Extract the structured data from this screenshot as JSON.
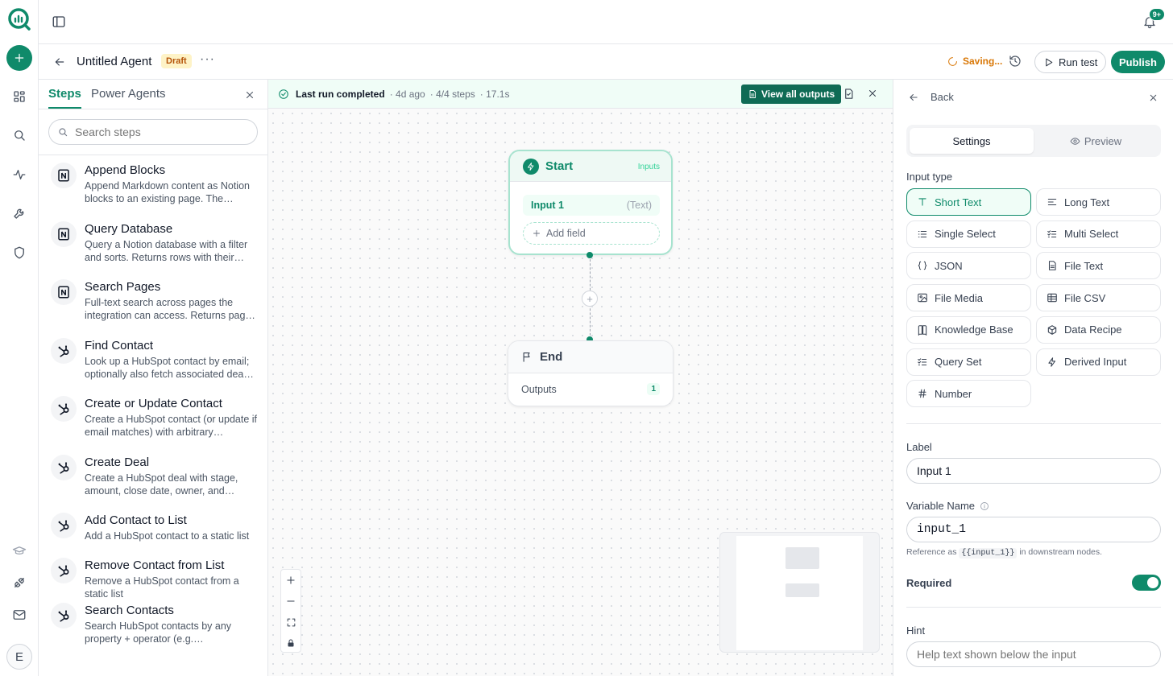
{
  "topbar": {
    "notification_badge": "9+"
  },
  "agent": {
    "title": "Untitled Agent",
    "status": "Draft",
    "more": "···",
    "saving": "Saving...",
    "run_test": "Run test",
    "publish": "Publish"
  },
  "rail": {
    "avatar_initial": "E"
  },
  "steps_panel": {
    "tabs": [
      "Steps",
      "Power Agents"
    ],
    "search_placeholder": "Search steps",
    "items": [
      {
        "title": "Append Blocks",
        "desc": "Append Markdown content as Notion blocks to an existing page. The…",
        "icon": "notion-icon"
      },
      {
        "title": "Query Database",
        "desc": "Query a Notion database with a filter and sorts. Returns rows with their…",
        "icon": "notion-icon"
      },
      {
        "title": "Search Pages",
        "desc": "Full-text search across pages the integration can access. Returns pag…",
        "icon": "notion-icon"
      },
      {
        "title": "Find Contact",
        "desc": "Look up a HubSpot contact by email; optionally also fetch associated dea…",
        "icon": "hubspot-icon"
      },
      {
        "title": "Create or Update Contact",
        "desc": "Create a HubSpot contact (or update if email matches) with arbitrary…",
        "icon": "hubspot-icon"
      },
      {
        "title": "Create Deal",
        "desc": "Create a HubSpot deal with stage, amount, close date, owner, and…",
        "icon": "hubspot-icon"
      },
      {
        "title": "Add Contact to List",
        "desc": "Add a HubSpot contact to a static list",
        "icon": "hubspot-icon"
      },
      {
        "title": "Remove Contact from List",
        "desc": "Remove a HubSpot contact from a static list",
        "icon": "hubspot-icon"
      },
      {
        "title": "Search Contacts",
        "desc": "Search HubSpot contacts by any property + operator (e.g.…",
        "icon": "hubspot-icon"
      }
    ]
  },
  "canvas": {
    "banner": {
      "status": "Last run completed",
      "ago": "· 4d ago",
      "steps": "· 4/4 steps",
      "duration": "· 17.1s",
      "view_outputs": "View all outputs"
    },
    "start_node": {
      "title": "Start",
      "inputs_label": "Inputs",
      "input_name": "Input 1",
      "input_type": "(Text)",
      "add_field": "Add field"
    },
    "end_node": {
      "title": "End",
      "outputs_label": "Outputs",
      "outputs_count": "1"
    }
  },
  "panel": {
    "back": "Back",
    "tabs": {
      "settings": "Settings",
      "preview": "Preview"
    },
    "input_type_label": "Input type",
    "input_types": [
      {
        "label": "Short Text",
        "icon": "text-t-icon",
        "selected": true
      },
      {
        "label": "Long Text",
        "icon": "align-left-icon",
        "selected": false
      },
      {
        "label": "Single Select",
        "icon": "list-icon",
        "selected": false
      },
      {
        "label": "Multi Select",
        "icon": "checklist-icon",
        "selected": false
      },
      {
        "label": "JSON",
        "icon": "braces-icon",
        "selected": false
      },
      {
        "label": "File Text",
        "icon": "file-text-icon",
        "selected": false
      },
      {
        "label": "File Media",
        "icon": "image-icon",
        "selected": false
      },
      {
        "label": "File CSV",
        "icon": "table-icon",
        "selected": false
      },
      {
        "label": "Knowledge Base",
        "icon": "book-icon",
        "selected": false
      },
      {
        "label": "Data Recipe",
        "icon": "package-icon",
        "selected": false
      },
      {
        "label": "Query Set",
        "icon": "checklist-icon",
        "selected": false
      },
      {
        "label": "Derived Input",
        "icon": "bolt-icon",
        "selected": false
      },
      {
        "label": "Number",
        "icon": "hash-icon",
        "selected": false
      }
    ],
    "label_label": "Label",
    "label_value": "Input 1",
    "variable_label": "Variable Name",
    "variable_value": "input_1",
    "ref_prefix": "Reference as",
    "ref_code": "{{input_1}}",
    "ref_suffix": "in downstream nodes.",
    "required_label": "Required",
    "required": true,
    "hint_label": "Hint",
    "hint_placeholder": "Help text shown below the input"
  },
  "colors": {
    "accent": "#0f8a6a",
    "draft_bg": "#fef3c7",
    "draft_fg": "#b45309",
    "saving": "#d97706"
  }
}
